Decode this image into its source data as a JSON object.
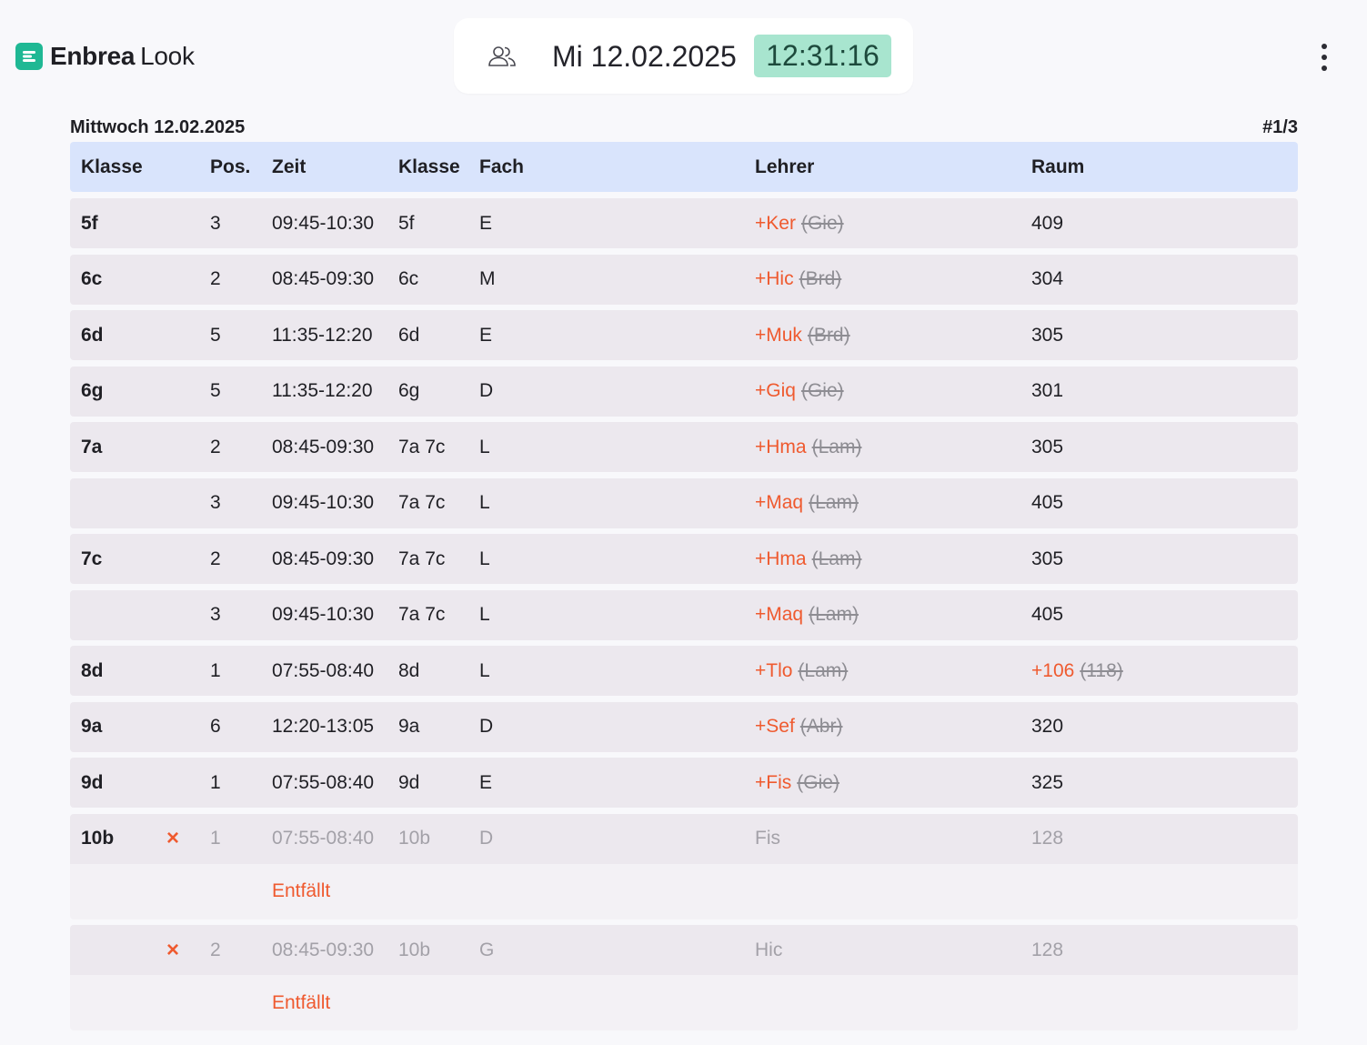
{
  "brand": {
    "name_bold": "Enbrea",
    "name_light": "Look"
  },
  "clock": {
    "date": "Mi 12.02.2025",
    "time": "12:31:16"
  },
  "day": {
    "title": "Mittwoch 12.02.2025",
    "page": "#1/3"
  },
  "columns": {
    "klasse": "Klasse",
    "pos": "Pos.",
    "zeit": "Zeit",
    "klasse2": "Klasse",
    "fach": "Fach",
    "lehrer": "Lehrer",
    "raum": "Raum"
  },
  "rows": [
    {
      "klasse": "5f",
      "pos": "3",
      "zeit": "09:45-10:30",
      "klasse2": "5f",
      "fach": "E",
      "lehrer_new": "+Ker",
      "lehrer_old": "(Gie)",
      "raum": "409"
    },
    {
      "klasse": "6c",
      "pos": "2",
      "zeit": "08:45-09:30",
      "klasse2": "6c",
      "fach": "M",
      "lehrer_new": "+Hic",
      "lehrer_old": "(Brd)",
      "raum": "304"
    },
    {
      "klasse": "6d",
      "pos": "5",
      "zeit": "11:35-12:20",
      "klasse2": "6d",
      "fach": "E",
      "lehrer_new": "+Muk",
      "lehrer_old": "(Brd)",
      "raum": "305"
    },
    {
      "klasse": "6g",
      "pos": "5",
      "zeit": "11:35-12:20",
      "klasse2": "6g",
      "fach": "D",
      "lehrer_new": "+Giq",
      "lehrer_old": "(Gie)",
      "raum": "301"
    },
    {
      "klasse": "7a",
      "pos": "2",
      "zeit": "08:45-09:30",
      "klasse2": "7a 7c",
      "fach": "L",
      "lehrer_new": "+Hma",
      "lehrer_old": "(Lam)",
      "raum": "305"
    },
    {
      "klasse": "",
      "pos": "3",
      "zeit": "09:45-10:30",
      "klasse2": "7a 7c",
      "fach": "L",
      "lehrer_new": "+Maq",
      "lehrer_old": "(Lam)",
      "raum": "405"
    },
    {
      "klasse": "7c",
      "pos": "2",
      "zeit": "08:45-09:30",
      "klasse2": "7a 7c",
      "fach": "L",
      "lehrer_new": "+Hma",
      "lehrer_old": "(Lam)",
      "raum": "305"
    },
    {
      "klasse": "",
      "pos": "3",
      "zeit": "09:45-10:30",
      "klasse2": "7a 7c",
      "fach": "L",
      "lehrer_new": "+Maq",
      "lehrer_old": "(Lam)",
      "raum": "405"
    },
    {
      "klasse": "8d",
      "pos": "1",
      "zeit": "07:55-08:40",
      "klasse2": "8d",
      "fach": "L",
      "lehrer_new": "+Tlo",
      "lehrer_old": "(Lam)",
      "raum_new": "+106",
      "raum_old": "(118)"
    },
    {
      "klasse": "9a",
      "pos": "6",
      "zeit": "12:20-13:05",
      "klasse2": "9a",
      "fach": "D",
      "lehrer_new": "+Sef",
      "lehrer_old": "(Abr)",
      "raum": "320"
    },
    {
      "klasse": "9d",
      "pos": "1",
      "zeit": "07:55-08:40",
      "klasse2": "9d",
      "fach": "E",
      "lehrer_new": "+Fis",
      "lehrer_old": "(Gie)",
      "raum": "325"
    }
  ],
  "cancelled": [
    {
      "klasse": "10b",
      "mark": "×",
      "pos": "1",
      "zeit": "07:55-08:40",
      "klasse2": "10b",
      "fach": "D",
      "lehrer": "Fis",
      "raum": "128",
      "note": "Entfällt"
    },
    {
      "klasse": "",
      "mark": "×",
      "pos": "2",
      "zeit": "08:45-09:30",
      "klasse2": "10b",
      "fach": "G",
      "lehrer": "Hic",
      "raum": "128",
      "note": "Entfällt"
    }
  ],
  "colors": {
    "accent_green": "#1fb894",
    "time_badge": "#a8e5cf",
    "header_row": "#d9e4fc",
    "row_bg": "#ece8ee",
    "substitution": "#ef5a2f"
  },
  "icons": {
    "logo": "enbrea-logo-icon",
    "switch_view": "users-icon",
    "menu": "more-vertical-icon",
    "cancel": "cancel-x-icon"
  }
}
